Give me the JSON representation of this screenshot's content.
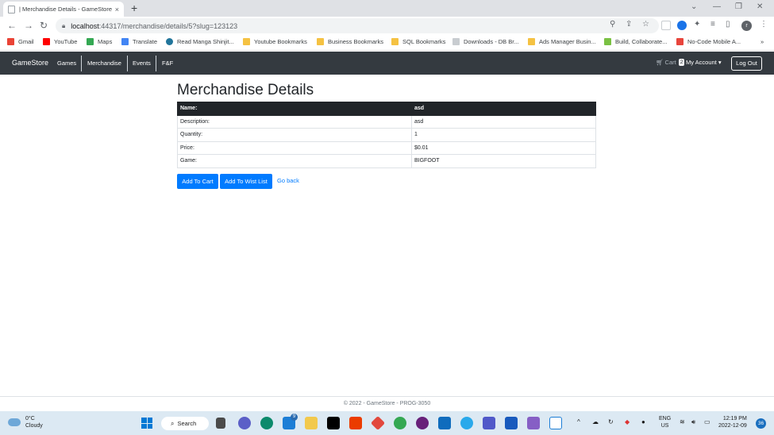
{
  "browser": {
    "tab_title": "| Merchandise Details - GameStore",
    "tab_close": "×",
    "new_tab": "+",
    "url_host": "localhost",
    "url_rest": ":44317/merchandise/details/5?slug=123123",
    "bookmarks": [
      {
        "label": "Gmail",
        "color": "#ea4335"
      },
      {
        "label": "YouTube",
        "color": "#ff0000"
      },
      {
        "label": "Maps",
        "color": "#34a853"
      },
      {
        "label": "Translate",
        "color": "#4285f4"
      },
      {
        "label": "Read Manga Shinjit...",
        "color": "#21759b"
      },
      {
        "label": "Youtube Bookmarks",
        "color": "#f5c242"
      },
      {
        "label": "Business Bookmarks",
        "color": "#f5c242"
      },
      {
        "label": "SQL Bookmarks",
        "color": "#f5c242"
      },
      {
        "label": "Downloads - DB Br...",
        "color": "#c8ccd0"
      },
      {
        "label": "Ads Manager Busin...",
        "color": "#f5c242"
      },
      {
        "label": "Build, Collaborate...",
        "color": "#7ac143"
      },
      {
        "label": "No-Code Mobile A...",
        "color": "#e8453c"
      }
    ],
    "profile_initial": "r"
  },
  "site": {
    "brand": "GameStore",
    "nav": [
      "Games",
      "Merchandise",
      "Events",
      "F&F"
    ],
    "cart_label": "Cart",
    "cart_count": "2",
    "account_label": "My Account ▾",
    "logout_label": "Log Out"
  },
  "page": {
    "heading": "Merchandise Details",
    "rows": [
      {
        "key": "Name:",
        "value": "asd"
      },
      {
        "key": "Description:",
        "value": "asd"
      },
      {
        "key": "Quantity:",
        "value": "1"
      },
      {
        "key": "Price:",
        "value": "$0.01"
      },
      {
        "key": "Game:",
        "value": "BIGFOOT"
      }
    ],
    "add_to_cart": "Add To Cart",
    "add_to_wishlist": "Add To Wist List",
    "go_back": "Go back"
  },
  "footer": {
    "text": "© 2022 - GameStore - PROG-3050"
  },
  "taskbar": {
    "temperature": "0°C",
    "condition": "Cloudy",
    "search": "Search",
    "lang_top": "ENG",
    "lang_bottom": "US",
    "time": "12:19 PM",
    "date": "2022-12-09",
    "notifications": "36",
    "mail_badge": "9"
  }
}
